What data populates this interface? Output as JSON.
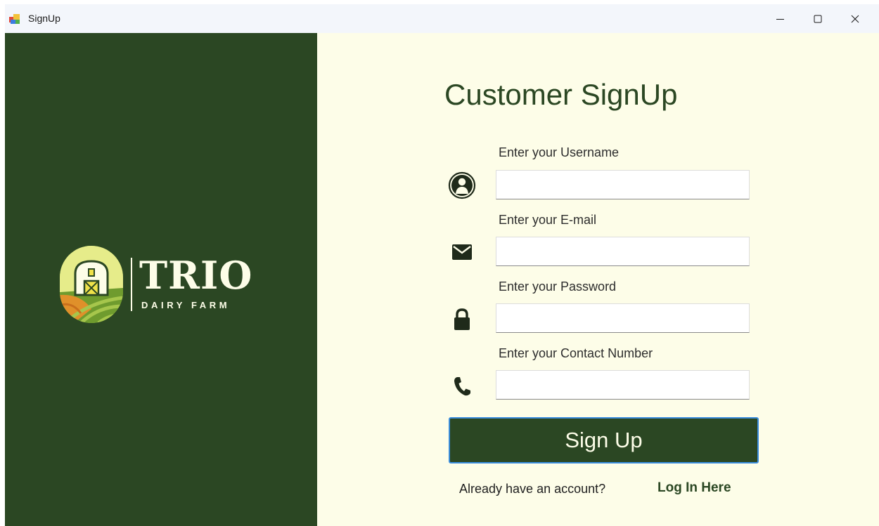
{
  "window": {
    "title": "SignUp",
    "controls": {
      "minimize_icon": "minimize-icon",
      "maximize_icon": "maximize-icon",
      "close_icon": "close-icon"
    }
  },
  "brand": {
    "name": "TRIO",
    "subtitle": "DAIRY FARM",
    "colors": {
      "panel": "#2b4723",
      "cream": "#fdfde8",
      "accent_green": "#a6c64c",
      "accent_orange": "#e0902a",
      "yellow": "#f0e24a"
    }
  },
  "form": {
    "heading": "Customer SignUp",
    "fields": [
      {
        "label": "Enter your Username",
        "icon": "user-icon",
        "value": ""
      },
      {
        "label": "Enter your E-mail",
        "icon": "envelope-icon",
        "value": ""
      },
      {
        "label": "Enter your Password",
        "icon": "lock-icon",
        "value": ""
      },
      {
        "label": "Enter your Contact Number",
        "icon": "phone-icon",
        "value": ""
      }
    ],
    "submit_label": "Sign Up",
    "footer": {
      "prompt": "Already have an account?",
      "link": "Log In Here"
    }
  }
}
